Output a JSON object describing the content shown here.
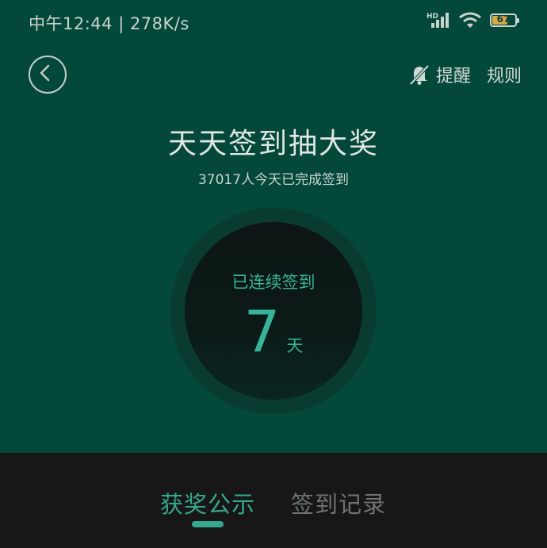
{
  "status_bar": {
    "time_speed": "中午12:44 | 278K/s",
    "network_label": "HD",
    "battery_level": "67",
    "battery_fraction": 0.67
  },
  "header": {
    "back_icon": "chevron-left-icon",
    "reminder_label": "提醒",
    "rules_label": "规则"
  },
  "main": {
    "title": "天天签到抽大奖",
    "subtitle": "37017人今天已完成签到",
    "streak_label": "已连续签到",
    "streak_days": "7",
    "streak_unit": "天"
  },
  "tabs": [
    {
      "label": "获奖公示",
      "active": true
    },
    {
      "label": "签到记录",
      "active": false
    }
  ],
  "colors": {
    "background": "#04483a",
    "accent": "#36b398",
    "panel": "#171717"
  }
}
